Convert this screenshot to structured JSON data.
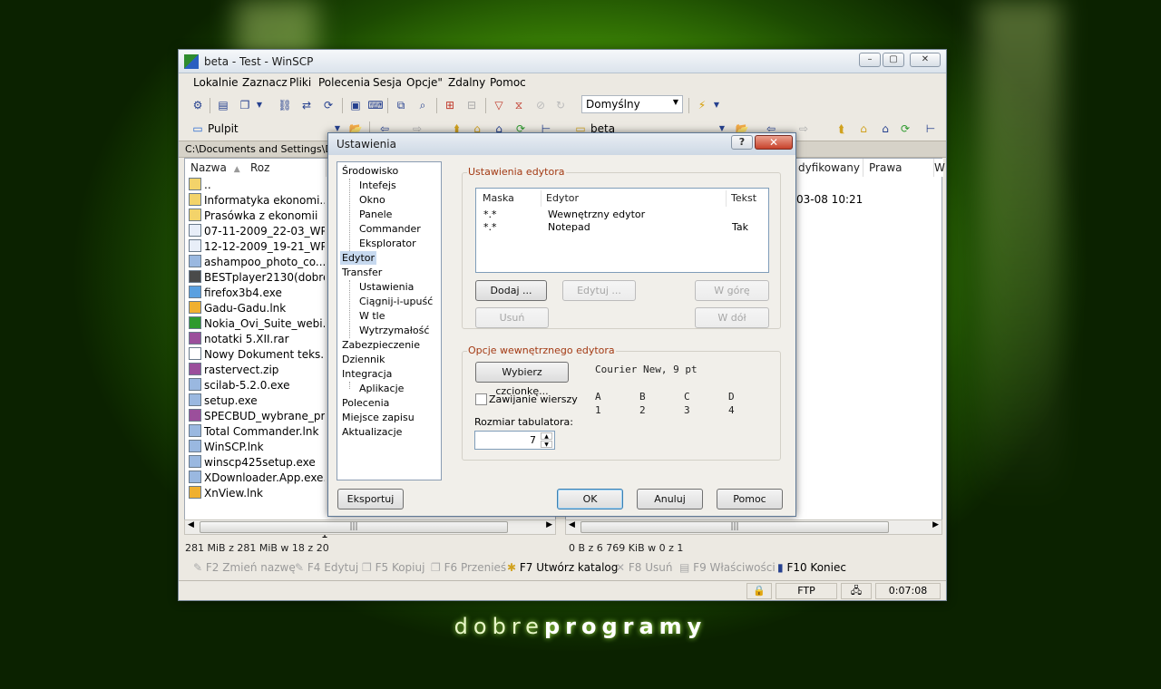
{
  "window": {
    "title": "beta - Test - WinSCP",
    "minimize": "–",
    "maximize": "▢",
    "close": "✕"
  },
  "menu": [
    "Lokalnie",
    "Zaznacz",
    "Pliki",
    "Polecenia",
    "Sesja",
    "Opcje\"",
    "Zdalny",
    "Pomoc"
  ],
  "toolbar": {
    "profile": "Domyślny"
  },
  "local_nav": {
    "location": "Pulpit"
  },
  "remote_nav": {
    "location": "beta"
  },
  "local_path": "C:\\Documents and Settings\\Dan",
  "local_columns": {
    "name": "Nazwa",
    "size": "Roz"
  },
  "remote_columns": {
    "modified": "dyfikowany",
    "rights": "Prawa",
    "more": "W"
  },
  "local_files": [
    {
      "name": "..",
      "icon": "parent"
    },
    {
      "name": "Informatyka ekonomi...",
      "icon": "folder"
    },
    {
      "name": "Prasówka z ekonomii",
      "icon": "folder"
    },
    {
      "name": "07-11-2009_22-03_WP...",
      "icon": "doc"
    },
    {
      "name": "12-12-2009_19-21_WP...",
      "icon": "doc"
    },
    {
      "name": "ashampoo_photo_co...",
      "icon": "app"
    },
    {
      "name": "BESTplayer2130(dobre...",
      "icon": "film"
    },
    {
      "name": "firefox3b4.exe",
      "icon": "globe"
    },
    {
      "name": "Gadu-Gadu.lnk",
      "icon": "sun"
    },
    {
      "name": "Nokia_Ovi_Suite_webi...",
      "icon": "ovi"
    },
    {
      "name": "notatki 5.XII.rar",
      "icon": "rar"
    },
    {
      "name": "Nowy Dokument teks...",
      "icon": "txt"
    },
    {
      "name": "rastervect.zip",
      "icon": "rar"
    },
    {
      "name": "scilab-5.2.0.exe",
      "icon": "app"
    },
    {
      "name": "setup.exe",
      "icon": "app"
    },
    {
      "name": "SPECBUD_wybrane_pr...",
      "icon": "rar"
    },
    {
      "name": "Total Commander.lnk",
      "icon": "app"
    },
    {
      "name": "WinSCP.lnk",
      "icon": "app"
    },
    {
      "name": "winscp425setup.exe",
      "icon": "app"
    },
    {
      "name": "XDownloader.App.exe...",
      "icon": "app"
    },
    {
      "name": "XnView.lnk",
      "icon": "sun"
    }
  ],
  "local_size_fragment": "1",
  "remote_files": [
    {
      "modified": "03-08 10:21"
    }
  ],
  "status": {
    "local": "281 MiB z 281 MiB w 18 z 20",
    "remote": "0 B z 6 769 KiB w 0 z 1",
    "protocol": "FTP",
    "time": "0:07:08"
  },
  "fkeys": [
    {
      "label": "F2 Zmień nazwę",
      "enabled": false
    },
    {
      "label": "F4 Edytuj",
      "enabled": false
    },
    {
      "label": "F5 Kopiuj",
      "enabled": false
    },
    {
      "label": "F6 Przenieś",
      "enabled": false
    },
    {
      "label": "F7 Utwórz katalog",
      "enabled": true
    },
    {
      "label": "F8 Usuń",
      "enabled": false
    },
    {
      "label": "F9 Właściwości",
      "enabled": false
    },
    {
      "label": "F10 Koniec",
      "enabled": true
    }
  ],
  "dialog": {
    "title": "Ustawienia",
    "help": "?",
    "close": "✕",
    "tree": [
      {
        "label": "Środowisko",
        "level": 0
      },
      {
        "label": "Intefejs",
        "level": 1
      },
      {
        "label": "Okno",
        "level": 1
      },
      {
        "label": "Panele",
        "level": 1
      },
      {
        "label": "Commander",
        "level": 1
      },
      {
        "label": "Eksplorator",
        "level": 1
      },
      {
        "label": "Edytor",
        "level": 0,
        "selected": true
      },
      {
        "label": "Transfer",
        "level": 0
      },
      {
        "label": "Ustawienia",
        "level": 1
      },
      {
        "label": "Ciągnij-i-upuść",
        "level": 1
      },
      {
        "label": "W tle",
        "level": 1
      },
      {
        "label": "Wytrzymałość",
        "level": 1
      },
      {
        "label": "Zabezpieczenie",
        "level": 0
      },
      {
        "label": "Dziennik",
        "level": 0
      },
      {
        "label": "Integracja",
        "level": 0
      },
      {
        "label": "Aplikacje",
        "level": 1
      },
      {
        "label": "Polecenia",
        "level": 0
      },
      {
        "label": "Miejsce zapisu",
        "level": 0
      },
      {
        "label": "Aktualizacje",
        "level": 0
      }
    ],
    "editors_group": "Ustawienia edytora",
    "editor_columns": {
      "mask": "Maska",
      "editor": "Edytor",
      "text": "Tekst"
    },
    "editors": [
      {
        "mask": "*.*",
        "editor": "Wewnętrzny edytor",
        "text": ""
      },
      {
        "mask": "*.*",
        "editor": "Notepad",
        "text": "Tak"
      }
    ],
    "buttons": {
      "add": "Dodaj ...",
      "edit": "Edytuj ...",
      "up": "W górę",
      "remove": "Usuń",
      "down": "W dół"
    },
    "internal_group": "Opcje wewnętrznego edytora",
    "choose_font": "Wybierz czcionkę...",
    "font_name": "Courier New, 9 pt",
    "font_preview": {
      "letters": [
        "A",
        "B",
        "C",
        "D"
      ],
      "digits": [
        "1",
        "2",
        "3",
        "4"
      ]
    },
    "word_wrap": {
      "label": "Zawijanie wierszy",
      "checked": false
    },
    "tab_size_label": "Rozmiar tabulatora:",
    "tab_size": "7",
    "export": "Eksportuj",
    "ok": "OK",
    "cancel": "Anuluj",
    "help_button": "Pomoc"
  },
  "branding": {
    "light": "dobre",
    "bold": "programy"
  }
}
